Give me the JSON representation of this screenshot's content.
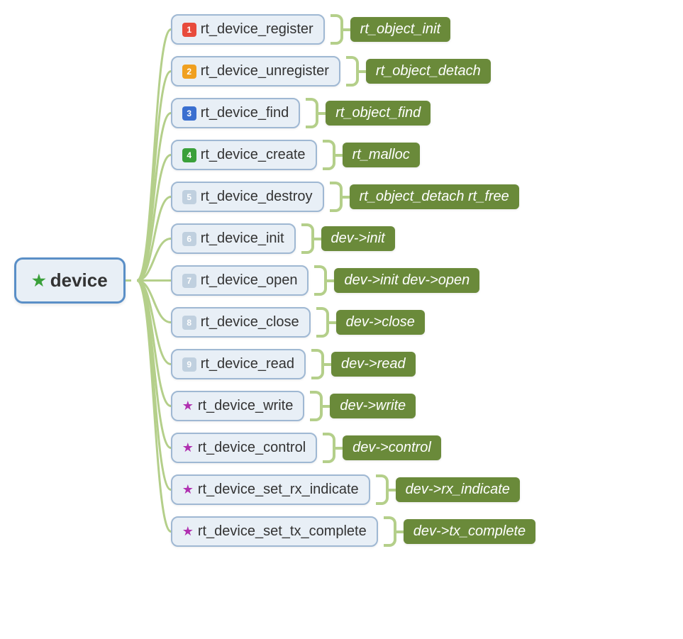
{
  "root": {
    "label": "device",
    "icon": "star-green"
  },
  "children": [
    {
      "badge": {
        "text": "1",
        "bg": "#e84b3c"
      },
      "label": "rt_device_register",
      "tag": "rt_object_init"
    },
    {
      "badge": {
        "text": "2",
        "bg": "#f0a020"
      },
      "label": "rt_device_unregister",
      "tag": "rt_object_detach"
    },
    {
      "badge": {
        "text": "3",
        "bg": "#3a6fd0"
      },
      "label": "rt_device_find",
      "tag": "rt_object_find"
    },
    {
      "badge": {
        "text": "4",
        "bg": "#3aa03a"
      },
      "label": "rt_device_create",
      "tag": "rt_malloc"
    },
    {
      "badge": {
        "text": "5",
        "bg": "#c0d0df"
      },
      "label": "rt_device_destroy",
      "tag": "rt_object_detach rt_free"
    },
    {
      "badge": {
        "text": "6",
        "bg": "#c0d0df"
      },
      "label": "rt_device_init",
      "tag": "dev->init"
    },
    {
      "badge": {
        "text": "7",
        "bg": "#c0d0df"
      },
      "label": "rt_device_open",
      "tag": "dev->init dev->open"
    },
    {
      "badge": {
        "text": "8",
        "bg": "#c0d0df"
      },
      "label": "rt_device_close",
      "tag": "dev->close"
    },
    {
      "badge": {
        "text": "9",
        "bg": "#c0d0df"
      },
      "label": "rt_device_read",
      "tag": "dev->read"
    },
    {
      "icon": "star-purple",
      "label": "rt_device_write",
      "tag": "dev->write"
    },
    {
      "icon": "star-purple",
      "label": "rt_device_control",
      "tag": "dev->control"
    },
    {
      "icon": "star-purple",
      "label": "rt_device_set_rx_indicate",
      "tag": "dev->rx_indicate"
    },
    {
      "icon": "star-purple",
      "label": "rt_device_set_tx_complete",
      "tag": "dev->tx_complete"
    }
  ],
  "colors": {
    "node_bg": "#e8eff6",
    "root_border": "#5a8fc7",
    "child_border": "#9fb8d3",
    "connector": "#b4cf8a",
    "tag_bg": "#6a8a3a"
  }
}
